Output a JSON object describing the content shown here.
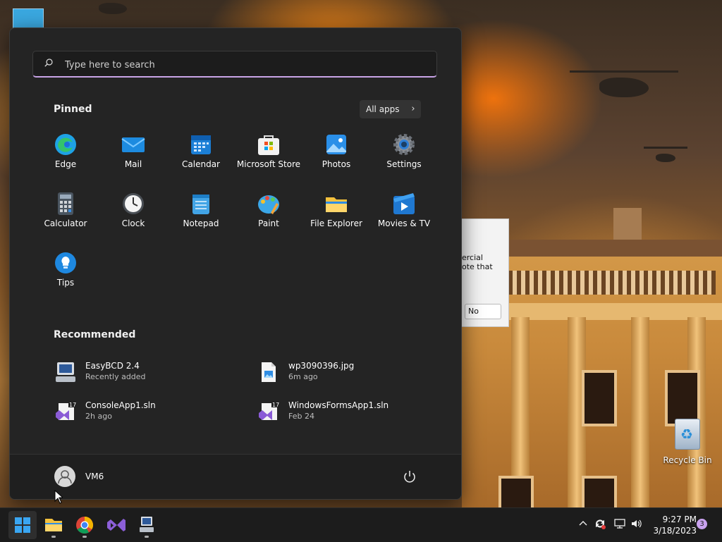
{
  "desktop": {
    "recycle_bin_label": "Recycle Bin",
    "dialog": {
      "text_line1": "ercial",
      "text_line2": "ote that",
      "no_button": "No"
    }
  },
  "start_menu": {
    "search": {
      "placeholder": "Type here to search"
    },
    "pinned": {
      "title": "Pinned",
      "all_apps_label": "All apps",
      "apps": [
        {
          "label": "Edge",
          "icon": "edge-icon"
        },
        {
          "label": "Mail",
          "icon": "mail-icon"
        },
        {
          "label": "Calendar",
          "icon": "calendar-icon"
        },
        {
          "label": "Microsoft Store",
          "icon": "store-icon"
        },
        {
          "label": "Photos",
          "icon": "photos-icon"
        },
        {
          "label": "Settings",
          "icon": "gear-icon"
        },
        {
          "label": "Calculator",
          "icon": "calculator-icon"
        },
        {
          "label": "Clock",
          "icon": "clock-icon"
        },
        {
          "label": "Notepad",
          "icon": "notepad-icon"
        },
        {
          "label": "Paint",
          "icon": "paint-icon"
        },
        {
          "label": "File Explorer",
          "icon": "folder-icon"
        },
        {
          "label": "Movies & TV",
          "icon": "movies-icon"
        },
        {
          "label": "Tips",
          "icon": "tips-icon"
        }
      ]
    },
    "recommended": {
      "title": "Recommended",
      "items": [
        {
          "name": "EasyBCD 2.4",
          "sub": "Recently added",
          "icon": "easybcd-icon"
        },
        {
          "name": "wp3090396.jpg",
          "sub": "6m ago",
          "icon": "image-file-icon"
        },
        {
          "name": "ConsoleApp1.sln",
          "sub": "2h ago",
          "icon": "visual-studio-solution-icon"
        },
        {
          "name": "WindowsFormsApp1.sln",
          "sub": "Feb 24",
          "icon": "visual-studio-solution-icon"
        }
      ]
    },
    "user": {
      "name": "VM6"
    }
  },
  "taskbar": {
    "apps": [
      "start-icon",
      "file-explorer-icon",
      "chrome-icon",
      "visual-studio-icon",
      "easybcd-icon"
    ],
    "clock": {
      "time": "9:27 PM",
      "date": "3/18/2023"
    },
    "notification_count": "3"
  },
  "colors": {
    "accent": "#c8a3e6",
    "start_bg": "#242424",
    "taskbar_bg": "#1c1c1c"
  }
}
